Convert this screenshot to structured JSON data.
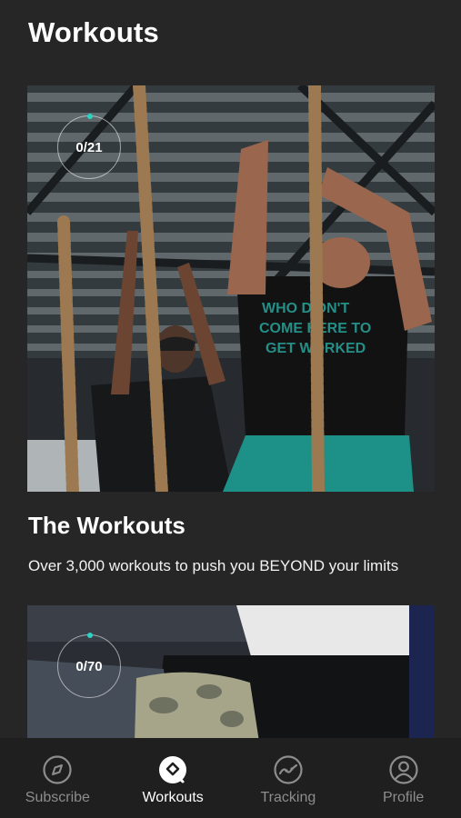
{
  "header": {
    "title": "Workouts"
  },
  "cards": [
    {
      "progress": "0/21"
    },
    {
      "progress": "0/70"
    }
  ],
  "section": {
    "title": "The Workouts",
    "description": "Over 3,000 workouts to push you BEYOND your limits"
  },
  "tabbar": {
    "items": [
      {
        "label": "Subscribe",
        "icon": "compass-icon",
        "active": false
      },
      {
        "label": "Workouts",
        "icon": "workouts-icon",
        "active": true
      },
      {
        "label": "Tracking",
        "icon": "tracking-chart-icon",
        "active": false
      },
      {
        "label": "Profile",
        "icon": "profile-icon",
        "active": false
      }
    ]
  },
  "colors": {
    "background": "#262626",
    "tabbar": "#1f1f1f",
    "accent": "#2ad4c4",
    "inactive": "#8d8d8d"
  }
}
